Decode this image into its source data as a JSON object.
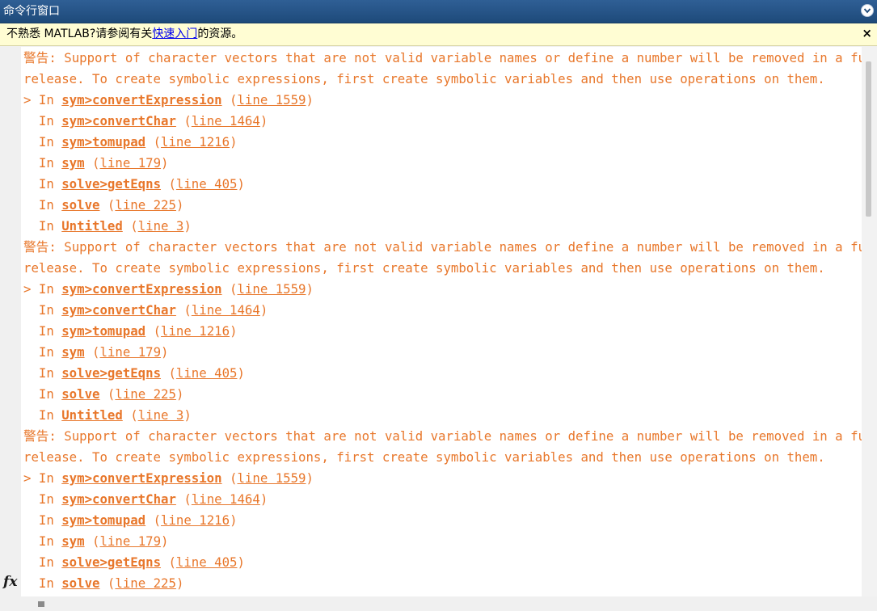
{
  "window": {
    "title": "命令行窗口",
    "menu_icon": "chevron-down-circle-icon"
  },
  "infobar": {
    "text_before": "不熟悉 MATLAB?请参阅有关",
    "link": "快速入门",
    "text_after": "的资源。",
    "close_label": "×"
  },
  "console": {
    "lines": [
      {
        "kind": "warn",
        "text": "警告: Support of character vectors that are not valid variable names or define a number will be removed in a future"
      },
      {
        "kind": "warn",
        "text": "release. To create symbolic expressions, first create symbolic variables and then use operations on them."
      },
      {
        "kind": "trace",
        "prefix": "> In ",
        "fn": "sym>convertExpression",
        "gap": " ",
        "line": "line 1559"
      },
      {
        "kind": "trace",
        "prefix": "  In ",
        "fn": "sym>convertChar",
        "gap": " ",
        "line": "line 1464"
      },
      {
        "kind": "trace",
        "prefix": "  In ",
        "fn": "sym>tomupad",
        "gap": " ",
        "line": "line 1216"
      },
      {
        "kind": "trace",
        "prefix": "  In ",
        "fn": "sym",
        "gap": " ",
        "line": "line 179"
      },
      {
        "kind": "trace",
        "prefix": "  In ",
        "fn": "solve>getEqns",
        "gap": " ",
        "line": "line 405"
      },
      {
        "kind": "trace",
        "prefix": "  In ",
        "fn": "solve",
        "gap": " ",
        "line": "line 225"
      },
      {
        "kind": "trace",
        "prefix": "  In ",
        "fn": "Untitled",
        "gap": " ",
        "line": "line 3"
      },
      {
        "kind": "warn",
        "text": "警告: Support of character vectors that are not valid variable names or define a number will be removed in a future"
      },
      {
        "kind": "warn",
        "text": "release. To create symbolic expressions, first create symbolic variables and then use operations on them."
      },
      {
        "kind": "trace",
        "prefix": "> In ",
        "fn": "sym>convertExpression",
        "gap": " ",
        "line": "line 1559"
      },
      {
        "kind": "trace",
        "prefix": "  In ",
        "fn": "sym>convertChar",
        "gap": " ",
        "line": "line 1464"
      },
      {
        "kind": "trace",
        "prefix": "  In ",
        "fn": "sym>tomupad",
        "gap": " ",
        "line": "line 1216"
      },
      {
        "kind": "trace",
        "prefix": "  In ",
        "fn": "sym",
        "gap": " ",
        "line": "line 179"
      },
      {
        "kind": "trace",
        "prefix": "  In ",
        "fn": "solve>getEqns",
        "gap": " ",
        "line": "line 405"
      },
      {
        "kind": "trace",
        "prefix": "  In ",
        "fn": "solve",
        "gap": " ",
        "line": "line 225"
      },
      {
        "kind": "trace",
        "prefix": "  In ",
        "fn": "Untitled",
        "gap": " ",
        "line": "line 3"
      },
      {
        "kind": "warn",
        "text": "警告: Support of character vectors that are not valid variable names or define a number will be removed in a future"
      },
      {
        "kind": "warn",
        "text": "release. To create symbolic expressions, first create symbolic variables and then use operations on them."
      },
      {
        "kind": "trace",
        "prefix": "> In ",
        "fn": "sym>convertExpression",
        "gap": " ",
        "line": "line 1559"
      },
      {
        "kind": "trace",
        "prefix": "  In ",
        "fn": "sym>convertChar",
        "gap": " ",
        "line": "line 1464"
      },
      {
        "kind": "trace",
        "prefix": "  In ",
        "fn": "sym>tomupad",
        "gap": " ",
        "line": "line 1216"
      },
      {
        "kind": "trace",
        "prefix": "  In ",
        "fn": "sym",
        "gap": " ",
        "line": "line 179"
      },
      {
        "kind": "trace",
        "prefix": "  In ",
        "fn": "solve>getEqns",
        "gap": " ",
        "line": "line 405"
      },
      {
        "kind": "trace",
        "prefix": "  In ",
        "fn": "solve",
        "gap": " ",
        "line": "line 225"
      }
    ]
  },
  "prompt": {
    "fx_label": "fx",
    "icon": "function-icon"
  },
  "colors": {
    "warning_text": "#e8772b",
    "titlebar": "#2f5f95",
    "infobar_bg": "#fffdd3",
    "link": "#0000ee"
  }
}
